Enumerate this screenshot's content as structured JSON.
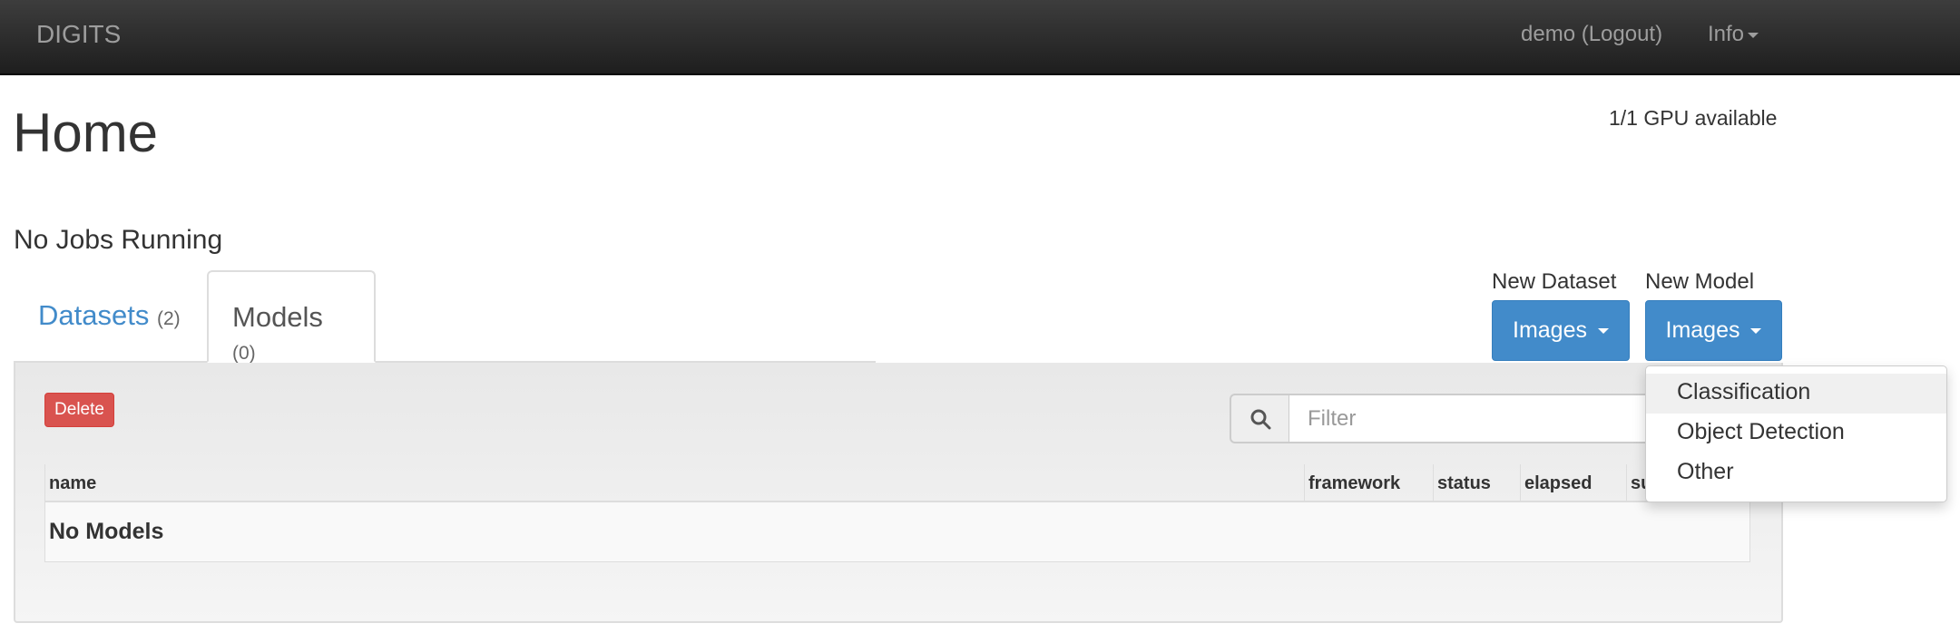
{
  "navbar": {
    "brand": "DIGITS",
    "user": "demo (Logout)",
    "info": "Info"
  },
  "page": {
    "title": "Home",
    "gpu_status": "1/1 GPU available",
    "jobs_status": "No Jobs Running"
  },
  "tabs": [
    {
      "label": "Datasets",
      "count": "(2)",
      "active": false
    },
    {
      "label": "Models",
      "count": "(0)",
      "active": true
    }
  ],
  "new_dataset": {
    "label": "New Dataset",
    "button": "Images"
  },
  "new_model": {
    "label": "New Model",
    "button": "Images"
  },
  "toolbar": {
    "delete_label": "Delete",
    "filter_placeholder": "Filter"
  },
  "table": {
    "columns": [
      "name",
      "framework",
      "status",
      "elapsed",
      "su"
    ],
    "empty_text": "No Models"
  },
  "dropdown": {
    "items": [
      "Classification",
      "Object Detection",
      "Other"
    ],
    "highlighted": "Classification"
  },
  "colors": {
    "primary": "#428bca",
    "danger": "#d9534f",
    "navbar": "#222222"
  }
}
